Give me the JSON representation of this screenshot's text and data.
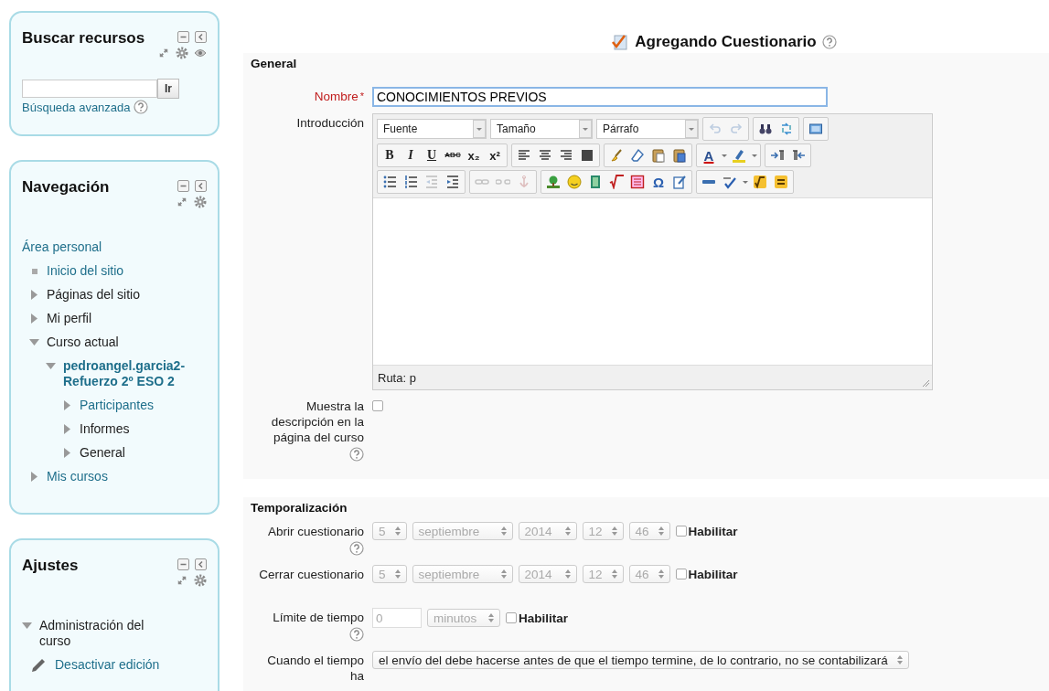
{
  "sidebar": {
    "blocks": [
      {
        "title": "Buscar recursos",
        "controls": [
          {
            "kind": "minimize"
          },
          {
            "kind": "dock"
          },
          {
            "kind": "move"
          },
          {
            "kind": "settings"
          },
          {
            "kind": "hide"
          }
        ],
        "search": {
          "button": "Ir",
          "link": "Búsqueda avanzada"
        }
      },
      {
        "title": "Navegación",
        "controls": [
          {
            "kind": "minimize"
          },
          {
            "kind": "dock"
          },
          {
            "kind": "move"
          },
          {
            "kind": "settings"
          }
        ],
        "tree": [
          {
            "label": "Área personal",
            "kind": "root",
            "link": true,
            "current": false,
            "children": [
              {
                "label": "Inicio del sitio",
                "kind": "leaf",
                "link": true,
                "current": false
              },
              {
                "label": "Páginas del sitio",
                "kind": "branch",
                "expanded": false,
                "link": false,
                "current": false
              },
              {
                "label": "Mi perfil",
                "kind": "branch",
                "expanded": false,
                "link": false,
                "current": false
              },
              {
                "label": "Curso actual",
                "kind": "branch",
                "expanded": true,
                "link": false,
                "current": false,
                "children": [
                  {
                    "label": "pedroangel.garcia2-Refuerzo 2º ESO 2",
                    "kind": "branch",
                    "expanded": true,
                    "link": true,
                    "current": true,
                    "children": [
                      {
                        "label": "Participantes",
                        "kind": "branch",
                        "expanded": false,
                        "link": true,
                        "current": false
                      },
                      {
                        "label": "Informes",
                        "kind": "branch",
                        "expanded": false,
                        "link": false,
                        "current": false
                      },
                      {
                        "label": "General",
                        "kind": "branch",
                        "expanded": false,
                        "link": false,
                        "current": false
                      }
                    ]
                  }
                ]
              },
              {
                "label": "Mis cursos",
                "kind": "branch",
                "expanded": false,
                "link": true,
                "current": false
              }
            ]
          }
        ]
      },
      {
        "title": "Ajustes",
        "controls": [
          {
            "kind": "minimize"
          },
          {
            "kind": "dock"
          },
          {
            "kind": "move"
          },
          {
            "kind": "settings"
          }
        ],
        "tree": [
          {
            "label": "Administración del curso",
            "kind": "branch",
            "expanded": true,
            "link": false,
            "current": false,
            "children": [
              {
                "label": "Desactivar edición",
                "kind": "action",
                "link": true,
                "current": false
              }
            ]
          }
        ]
      }
    ]
  },
  "main": {
    "title": "Agregando Cuestionario",
    "sections": [
      {
        "legend": "General",
        "rows": [
          {
            "kind": "text",
            "label": "Nombre",
            "required": true,
            "required_mark": "*",
            "help": false,
            "value": "CONOCIMIENTOS PREVIOS",
            "focused": true
          },
          {
            "kind": "editor",
            "label": "Introducción",
            "required": false,
            "help": false,
            "path": "Ruta: p",
            "toolbar": [
              [
                [
                  {
                    "kind": "select",
                    "label": "Fuente",
                    "disabled": false
                  }
                ],
                [
                  {
                    "kind": "select",
                    "label": "Tamaño",
                    "disabled": false
                  }
                ],
                [
                  {
                    "kind": "select",
                    "label": "Párrafo",
                    "disabled": false
                  }
                ],
                [
                  {
                    "kind": "undo",
                    "disabled": true
                  },
                  {
                    "kind": "redo",
                    "disabled": true
                  }
                ],
                [
                  {
                    "kind": "find",
                    "disabled": false
                  },
                  {
                    "kind": "replace",
                    "disabled": false
                  }
                ],
                [
                  {
                    "kind": "fullscreen",
                    "disabled": false
                  }
                ]
              ],
              [
                [
                  {
                    "kind": "bold",
                    "text": "B",
                    "disabled": false
                  },
                  {
                    "kind": "italic",
                    "text": "I",
                    "disabled": false
                  },
                  {
                    "kind": "underline",
                    "text": "U",
                    "disabled": false
                  },
                  {
                    "kind": "strike",
                    "text": "ABC",
                    "disabled": false
                  },
                  {
                    "kind": "subscript",
                    "text": "x₂",
                    "disabled": false
                  },
                  {
                    "kind": "superscript",
                    "text": "x²",
                    "disabled": false
                  }
                ],
                [
                  {
                    "kind": "align-left",
                    "disabled": false
                  },
                  {
                    "kind": "align-center",
                    "disabled": false
                  },
                  {
                    "kind": "align-right",
                    "disabled": false
                  },
                  {
                    "kind": "justify",
                    "disabled": false
                  }
                ],
                [
                  {
                    "kind": "cleanup",
                    "disabled": false
                  },
                  {
                    "kind": "eraser",
                    "disabled": false
                  },
                  {
                    "kind": "paste-text",
                    "disabled": false
                  },
                  {
                    "kind": "paste-word",
                    "disabled": false
                  }
                ],
                [
                  {
                    "kind": "color",
                    "text": "A",
                    "disabled": false
                  },
                  {
                    "kind": "menu",
                    "disabled": false
                  },
                  {
                    "kind": "highlight",
                    "disabled": false
                  },
                  {
                    "kind": "menu",
                    "disabled": false
                  }
                ],
                [
                  {
                    "kind": "ltr",
                    "disabled": false
                  },
                  {
                    "kind": "rtl",
                    "disabled": false
                  }
                ]
              ],
              [
                [
                  {
                    "kind": "bullets",
                    "disabled": false
                  },
                  {
                    "kind": "numbers",
                    "disabled": false
                  },
                  {
                    "kind": "outdent",
                    "disabled": true
                  },
                  {
                    "kind": "indent",
                    "disabled": false
                  }
                ],
                [
                  {
                    "kind": "link",
                    "disabled": true
                  },
                  {
                    "kind": "unlink",
                    "disabled": true
                  },
                  {
                    "kind": "anchor",
                    "disabled": true
                  }
                ],
                [
                  {
                    "kind": "image",
                    "disabled": false
                  },
                  {
                    "kind": "emoticon",
                    "disabled": false
                  },
                  {
                    "kind": "media",
                    "disabled": false
                  },
                  {
                    "kind": "equation",
                    "disabled": false
                  },
                  {
                    "kind": "math",
                    "disabled": false
                  },
                  {
                    "kind": "symbol",
                    "text": "Ω",
                    "disabled": false
                  },
                  {
                    "kind": "edit",
                    "disabled": false
                  }
                ],
                [
                  {
                    "kind": "html",
                    "disabled": false
                  },
                  {
                    "kind": "spellcheck",
                    "disabled": false
                  },
                  {
                    "kind": "menu",
                    "disabled": false
                  },
                  {
                    "kind": "sqrt",
                    "disabled": false
                  },
                  {
                    "kind": "equals",
                    "disabled": false
                  }
                ]
              ]
            ]
          },
          {
            "kind": "checkbox",
            "label": "Muestra la descripción en la página del curso",
            "required": false,
            "help": true,
            "checked": false
          }
        ]
      },
      {
        "legend": "Temporalización",
        "rows": [
          {
            "kind": "datetime",
            "label": "Abrir cuestionario",
            "required": false,
            "help": true,
            "fields": [
              "5",
              "septiembre",
              "2014",
              "12",
              "46"
            ],
            "enable_label": "Habilitar",
            "checked": false
          },
          {
            "kind": "datetime",
            "label": "Cerrar cuestionario",
            "required": false,
            "help": false,
            "fields": [
              "5",
              "septiembre",
              "2014",
              "12",
              "46"
            ],
            "enable_label": "Habilitar",
            "checked": false
          },
          {
            "kind": "duration",
            "label": "Límite de tiempo",
            "required": false,
            "help": true,
            "value": "0",
            "unit": "minutos",
            "enable_label": "Habilitar",
            "checked": false
          },
          {
            "kind": "select",
            "label": "Cuando el tiempo ha",
            "required": false,
            "help": false,
            "value": "el envío del debe hacerse antes de que el tiempo termine, de lo contrario, no se contabilizará"
          }
        ]
      }
    ]
  }
}
